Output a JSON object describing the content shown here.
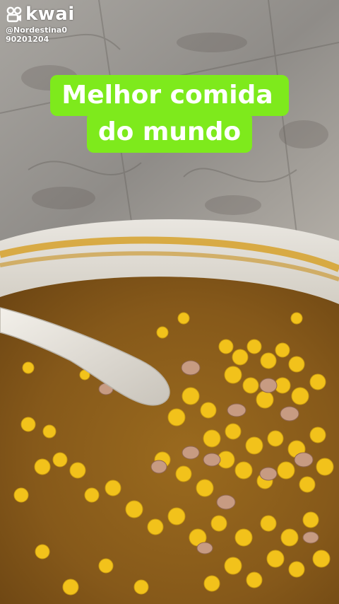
{
  "watermark": {
    "brand": "kwai",
    "handle": "@Nordestina0",
    "id_number": "90201204",
    "logo_icon": "kwai-logo-icon"
  },
  "caption": {
    "line1": "Melhor comida",
    "line2": "do mundo",
    "background_color": "#7eea1c",
    "text_color": "#ffffff"
  },
  "scene": {
    "description_icon": "soup-pot-photo"
  }
}
